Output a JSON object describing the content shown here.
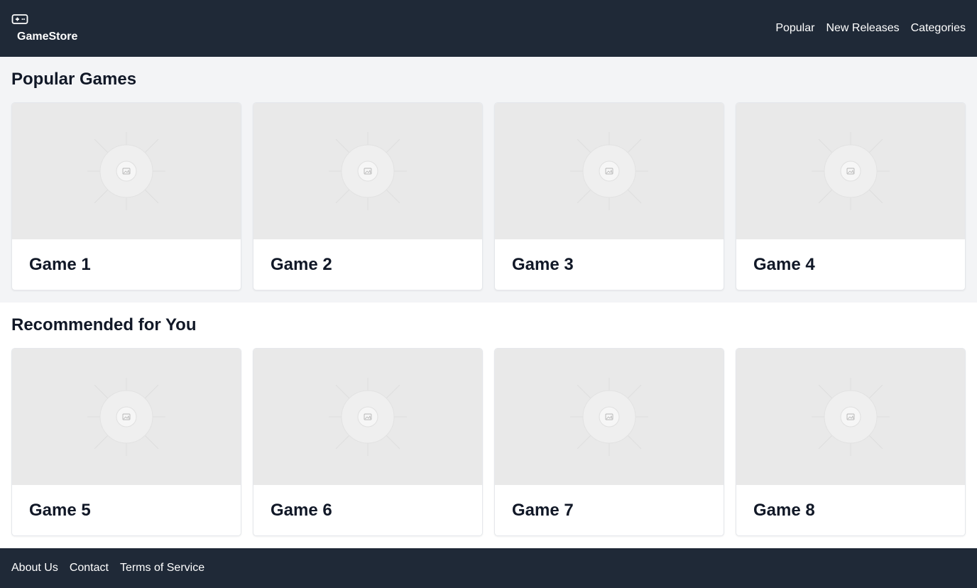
{
  "header": {
    "brand": "GameStore",
    "nav": [
      "Popular",
      "New Releases",
      "Categories"
    ]
  },
  "sections": [
    {
      "title": "Popular Games",
      "games": [
        "Game 1",
        "Game 2",
        "Game 3",
        "Game 4"
      ]
    },
    {
      "title": "Recommended for You",
      "games": [
        "Game 5",
        "Game 6",
        "Game 7",
        "Game 8"
      ]
    }
  ],
  "footer": {
    "links": [
      "About Us",
      "Contact",
      "Terms of Service"
    ]
  },
  "icons": {
    "logo": "gamepad-icon",
    "placeholder": "image-placeholder-icon"
  },
  "colors": {
    "header_bg": "#1f2937",
    "section_alt_bg": "#f3f4f6",
    "image_placeholder_bg": "#e9e9e9"
  }
}
